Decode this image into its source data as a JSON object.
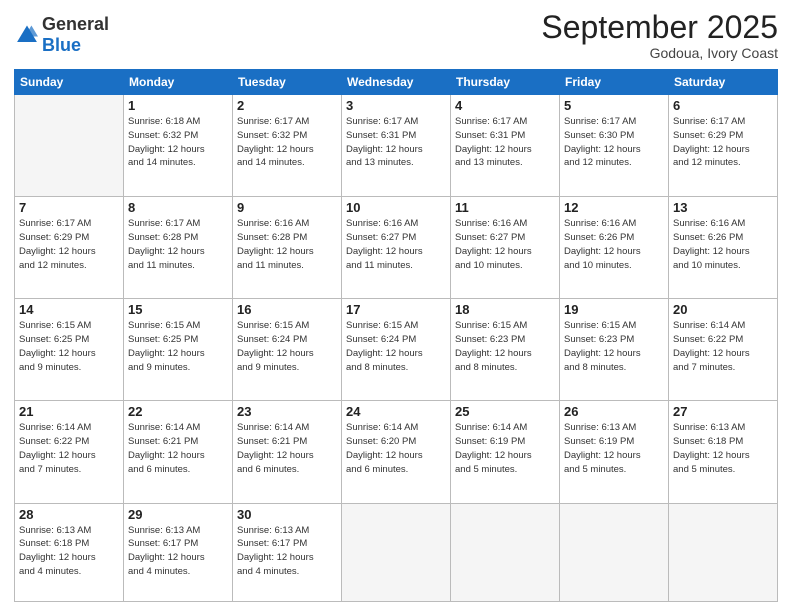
{
  "header": {
    "logo_general": "General",
    "logo_blue": "Blue",
    "month_title": "September 2025",
    "location": "Godoua, Ivory Coast"
  },
  "days_of_week": [
    "Sunday",
    "Monday",
    "Tuesday",
    "Wednesday",
    "Thursday",
    "Friday",
    "Saturday"
  ],
  "weeks": [
    [
      {
        "day": "",
        "info": ""
      },
      {
        "day": "1",
        "info": "Sunrise: 6:18 AM\nSunset: 6:32 PM\nDaylight: 12 hours\nand 14 minutes."
      },
      {
        "day": "2",
        "info": "Sunrise: 6:17 AM\nSunset: 6:32 PM\nDaylight: 12 hours\nand 14 minutes."
      },
      {
        "day": "3",
        "info": "Sunrise: 6:17 AM\nSunset: 6:31 PM\nDaylight: 12 hours\nand 13 minutes."
      },
      {
        "day": "4",
        "info": "Sunrise: 6:17 AM\nSunset: 6:31 PM\nDaylight: 12 hours\nand 13 minutes."
      },
      {
        "day": "5",
        "info": "Sunrise: 6:17 AM\nSunset: 6:30 PM\nDaylight: 12 hours\nand 12 minutes."
      },
      {
        "day": "6",
        "info": "Sunrise: 6:17 AM\nSunset: 6:29 PM\nDaylight: 12 hours\nand 12 minutes."
      }
    ],
    [
      {
        "day": "7",
        "info": "Sunrise: 6:17 AM\nSunset: 6:29 PM\nDaylight: 12 hours\nand 12 minutes."
      },
      {
        "day": "8",
        "info": "Sunrise: 6:17 AM\nSunset: 6:28 PM\nDaylight: 12 hours\nand 11 minutes."
      },
      {
        "day": "9",
        "info": "Sunrise: 6:16 AM\nSunset: 6:28 PM\nDaylight: 12 hours\nand 11 minutes."
      },
      {
        "day": "10",
        "info": "Sunrise: 6:16 AM\nSunset: 6:27 PM\nDaylight: 12 hours\nand 11 minutes."
      },
      {
        "day": "11",
        "info": "Sunrise: 6:16 AM\nSunset: 6:27 PM\nDaylight: 12 hours\nand 10 minutes."
      },
      {
        "day": "12",
        "info": "Sunrise: 6:16 AM\nSunset: 6:26 PM\nDaylight: 12 hours\nand 10 minutes."
      },
      {
        "day": "13",
        "info": "Sunrise: 6:16 AM\nSunset: 6:26 PM\nDaylight: 12 hours\nand 10 minutes."
      }
    ],
    [
      {
        "day": "14",
        "info": "Sunrise: 6:15 AM\nSunset: 6:25 PM\nDaylight: 12 hours\nand 9 minutes."
      },
      {
        "day": "15",
        "info": "Sunrise: 6:15 AM\nSunset: 6:25 PM\nDaylight: 12 hours\nand 9 minutes."
      },
      {
        "day": "16",
        "info": "Sunrise: 6:15 AM\nSunset: 6:24 PM\nDaylight: 12 hours\nand 9 minutes."
      },
      {
        "day": "17",
        "info": "Sunrise: 6:15 AM\nSunset: 6:24 PM\nDaylight: 12 hours\nand 8 minutes."
      },
      {
        "day": "18",
        "info": "Sunrise: 6:15 AM\nSunset: 6:23 PM\nDaylight: 12 hours\nand 8 minutes."
      },
      {
        "day": "19",
        "info": "Sunrise: 6:15 AM\nSunset: 6:23 PM\nDaylight: 12 hours\nand 8 minutes."
      },
      {
        "day": "20",
        "info": "Sunrise: 6:14 AM\nSunset: 6:22 PM\nDaylight: 12 hours\nand 7 minutes."
      }
    ],
    [
      {
        "day": "21",
        "info": "Sunrise: 6:14 AM\nSunset: 6:22 PM\nDaylight: 12 hours\nand 7 minutes."
      },
      {
        "day": "22",
        "info": "Sunrise: 6:14 AM\nSunset: 6:21 PM\nDaylight: 12 hours\nand 6 minutes."
      },
      {
        "day": "23",
        "info": "Sunrise: 6:14 AM\nSunset: 6:21 PM\nDaylight: 12 hours\nand 6 minutes."
      },
      {
        "day": "24",
        "info": "Sunrise: 6:14 AM\nSunset: 6:20 PM\nDaylight: 12 hours\nand 6 minutes."
      },
      {
        "day": "25",
        "info": "Sunrise: 6:14 AM\nSunset: 6:19 PM\nDaylight: 12 hours\nand 5 minutes."
      },
      {
        "day": "26",
        "info": "Sunrise: 6:13 AM\nSunset: 6:19 PM\nDaylight: 12 hours\nand 5 minutes."
      },
      {
        "day": "27",
        "info": "Sunrise: 6:13 AM\nSunset: 6:18 PM\nDaylight: 12 hours\nand 5 minutes."
      }
    ],
    [
      {
        "day": "28",
        "info": "Sunrise: 6:13 AM\nSunset: 6:18 PM\nDaylight: 12 hours\nand 4 minutes."
      },
      {
        "day": "29",
        "info": "Sunrise: 6:13 AM\nSunset: 6:17 PM\nDaylight: 12 hours\nand 4 minutes."
      },
      {
        "day": "30",
        "info": "Sunrise: 6:13 AM\nSunset: 6:17 PM\nDaylight: 12 hours\nand 4 minutes."
      },
      {
        "day": "",
        "info": ""
      },
      {
        "day": "",
        "info": ""
      },
      {
        "day": "",
        "info": ""
      },
      {
        "day": "",
        "info": ""
      }
    ]
  ]
}
